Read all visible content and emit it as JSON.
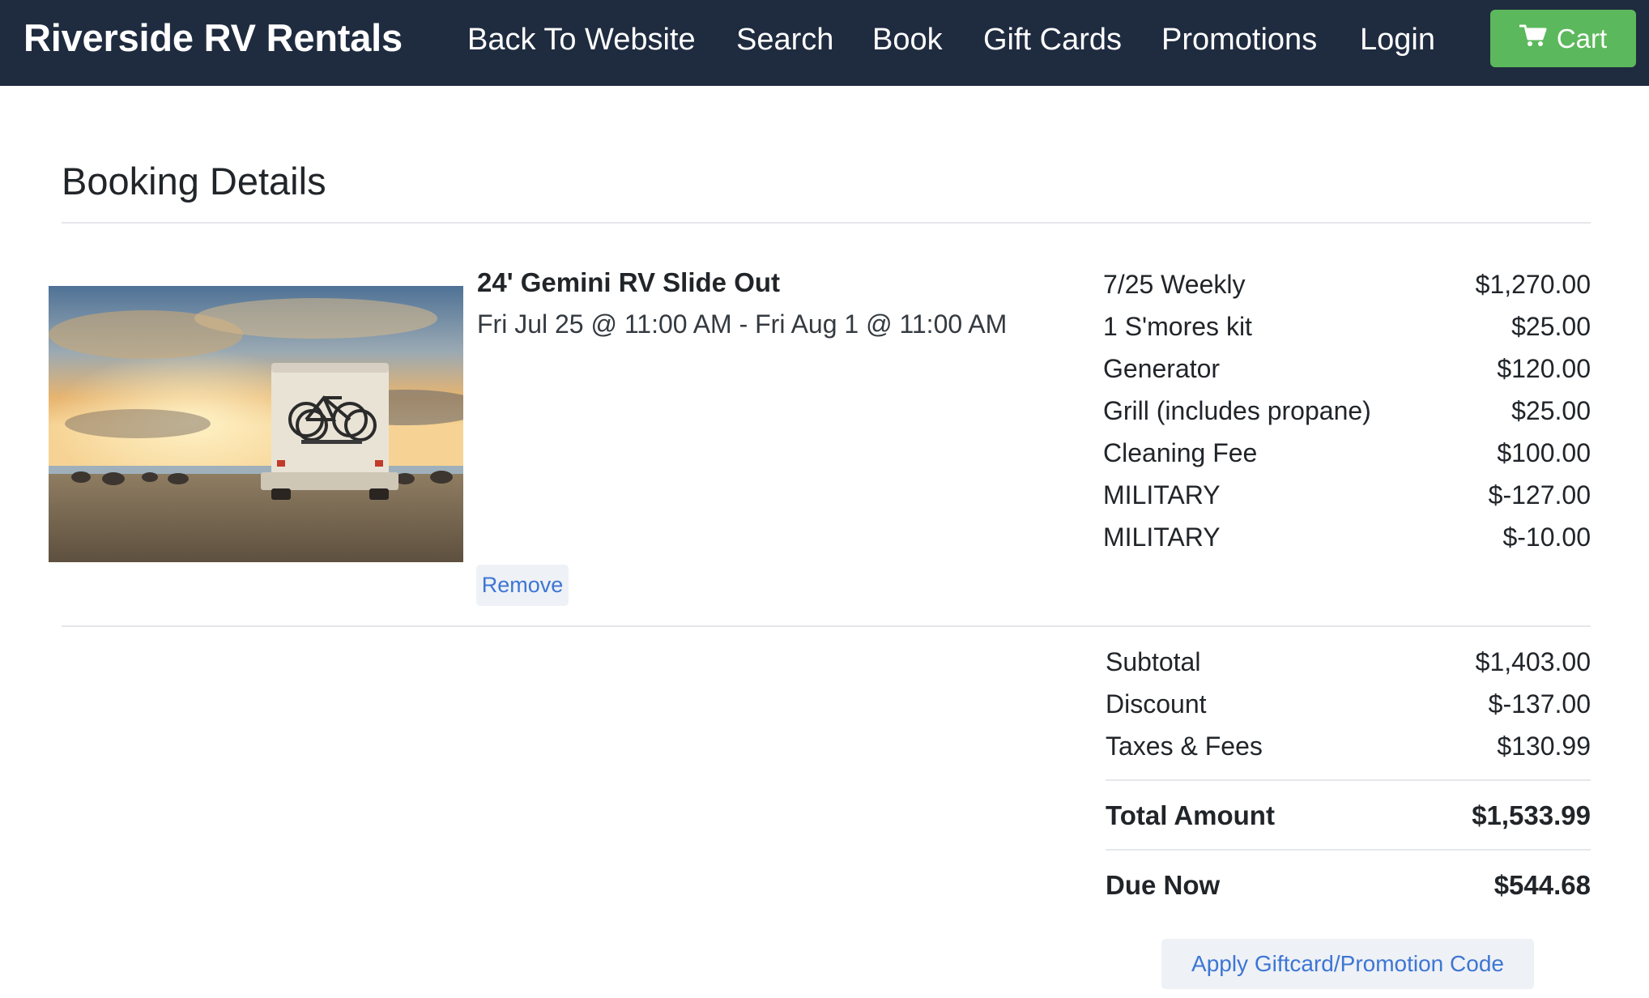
{
  "navbar": {
    "brand": "Riverside RV Rentals",
    "links": [
      {
        "label": "Back To Website"
      },
      {
        "label": "Search"
      },
      {
        "label": "Book"
      },
      {
        "label": "Gift Cards"
      },
      {
        "label": "Promotions"
      },
      {
        "label": "Login"
      }
    ],
    "cart": {
      "label": "Cart",
      "icon": "shopping-cart-icon",
      "color": "#5cb85c"
    },
    "background": "#1f2b3f"
  },
  "booking": {
    "title": "Booking Details",
    "item": {
      "name": "24' Gemini RV Slide Out",
      "dates": "Fri Jul 25 @ 11:00 AM - Fri Aug 1 @ 11:00 AM",
      "image": "rv-with-bicycles-at-sunset",
      "remove_label": "Remove"
    },
    "line_items": [
      {
        "label": "7/25 Weekly",
        "amount": "$1,270.00"
      },
      {
        "label": "1 S'mores kit",
        "amount": "$25.00"
      },
      {
        "label": "Generator",
        "amount": "$120.00"
      },
      {
        "label": "Grill (includes propane)",
        "amount": "$25.00"
      },
      {
        "label": "Cleaning Fee",
        "amount": "$100.00"
      },
      {
        "label": "MILITARY",
        "amount": "$-127.00"
      },
      {
        "label": "MILITARY",
        "amount": "$-10.00"
      }
    ],
    "summary": {
      "subtotal": {
        "label": "Subtotal",
        "amount": "$1,403.00"
      },
      "discount": {
        "label": "Discount",
        "amount": "$-137.00"
      },
      "taxes": {
        "label": "Taxes & Fees",
        "amount": "$130.99"
      },
      "total": {
        "label": "Total Amount",
        "amount": "$1,533.99"
      },
      "due_now": {
        "label": "Due Now",
        "amount": "$544.68"
      }
    },
    "promo_button_label": "Apply Giftcard/Promotion Code",
    "link_color": "#3d76d4"
  }
}
